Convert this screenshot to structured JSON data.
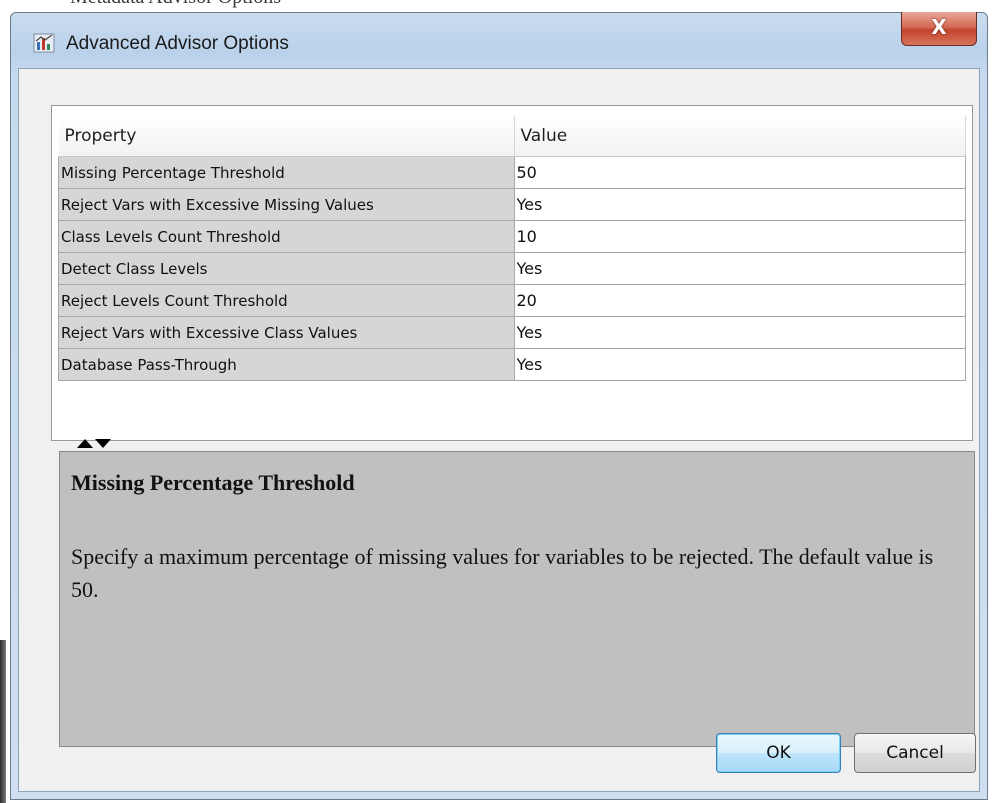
{
  "background": {
    "behind_window_text": "Metadata Advisor Options"
  },
  "window": {
    "title": "Advanced Advisor Options",
    "close_label": "X",
    "icon": "chart-app-icon"
  },
  "table": {
    "headers": [
      "Property",
      "Value"
    ],
    "rows": [
      {
        "property": "Missing Percentage Threshold",
        "value": "50"
      },
      {
        "property": "Reject Vars with Excessive Missing Values",
        "value": "Yes"
      },
      {
        "property": "Class Levels Count Threshold",
        "value": "10"
      },
      {
        "property": "Detect Class Levels",
        "value": "Yes"
      },
      {
        "property": "Reject Levels Count Threshold",
        "value": "20"
      },
      {
        "property": "Reject Vars with Excessive Class Values",
        "value": "Yes"
      },
      {
        "property": "Database Pass-Through",
        "value": "Yes"
      }
    ]
  },
  "description": {
    "title": "Missing Percentage Threshold",
    "body": "Specify a maximum percentage of missing values for variables to be rejected. The default value is 50."
  },
  "buttons": {
    "ok_label": "OK",
    "cancel_label": "Cancel"
  },
  "colors": {
    "title_bar": "#b9d1ea",
    "close_button": "#c7503a",
    "property_cell": "#d6d6d6",
    "description_panel": "#c0c0c0",
    "default_button_border": "#3c7fb1"
  }
}
